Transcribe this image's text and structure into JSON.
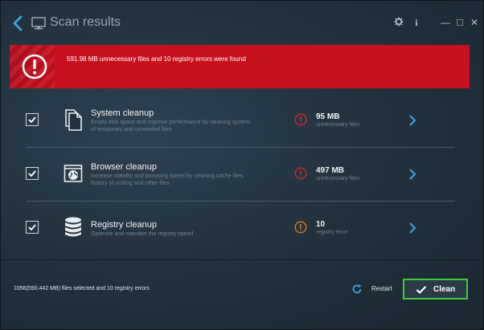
{
  "window": {
    "title": "Scan results",
    "settings_icon": "gear-icon",
    "info_label": "i",
    "minimize_label": "—",
    "maximize_label": "□",
    "close_label": "✕"
  },
  "alert": {
    "message": "591.98 MB unnecessary files and 10 registry errors were found",
    "color": "#c7111f"
  },
  "rows": [
    {
      "title": "System cleanup",
      "description": "Empty disk space and improve performance by cleaning system of temporary and unneeded files",
      "value": "95 MB",
      "unit": "unnecessary files",
      "checked": true,
      "status_color": "#d0242e"
    },
    {
      "title": "Browser cleanup",
      "description": "Increase stability and browsing speed by cleaning cache files, history of visiting and other files",
      "value": "497 MB",
      "unit": "unnecessary files",
      "checked": true,
      "status_color": "#d0242e"
    },
    {
      "title": "Registry cleanup",
      "description": "Optimize and maintain the registry speed",
      "value": "10",
      "unit": "registry error",
      "checked": true,
      "status_color": "#e07b1d"
    }
  ],
  "footer": {
    "summary": "1056(590.442 MB) files selected and 10 registry errors",
    "restart_label": "Restart",
    "clean_label": "Clean",
    "clean_border_color": "#3ecb3a",
    "accent_color": "#3aa0e0"
  }
}
